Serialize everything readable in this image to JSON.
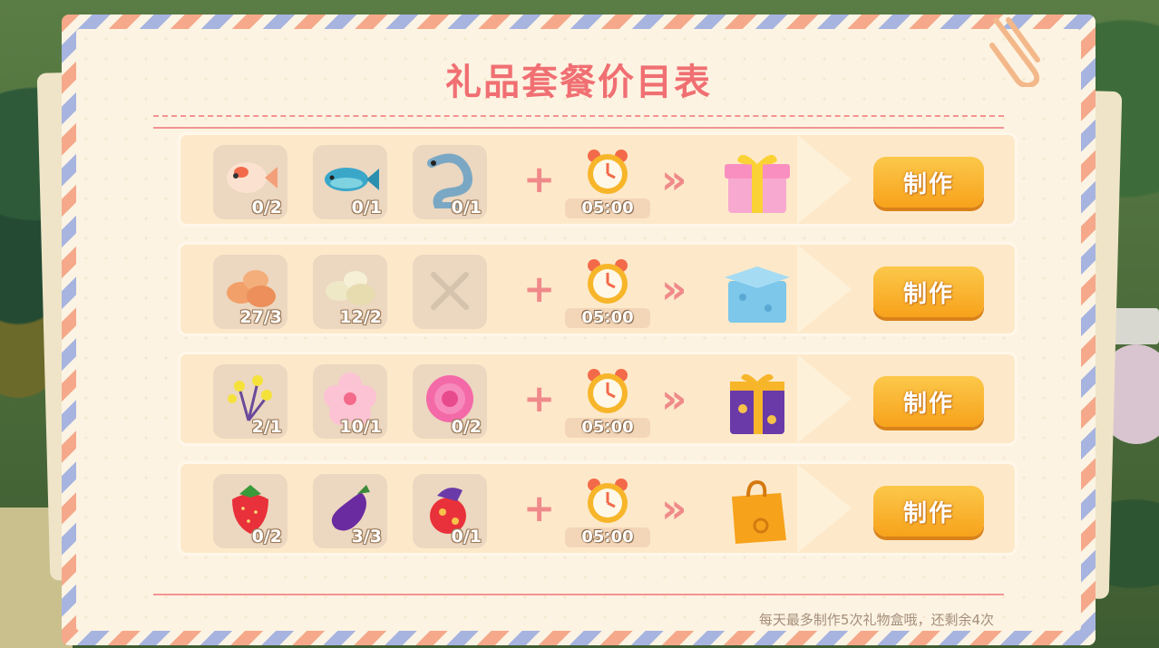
{
  "panel": {
    "title": "礼品套餐价目表",
    "footer_note": "每天最多制作5次礼物盒哦，还剩余4次"
  },
  "colors": {
    "accent": "#f06f72",
    "button": "#f7a21b",
    "row_bg": "#fde9c9"
  },
  "recipes": [
    {
      "ingredients": [
        {
          "icon": "koi-fish-icon",
          "count": "0/2"
        },
        {
          "icon": "blue-fish-icon",
          "count": "0/1"
        },
        {
          "icon": "eel-icon",
          "count": "0/1"
        }
      ],
      "plus": "+",
      "time": "05:00",
      "arrow": "»",
      "result_icon": "pink-gift-box-icon",
      "button": "制作"
    },
    {
      "ingredients": [
        {
          "icon": "brown-eggs-icon",
          "count": "27/3"
        },
        {
          "icon": "white-eggs-icon",
          "count": "12/2"
        },
        {
          "icon": "empty-slot-x-icon",
          "count": ""
        }
      ],
      "plus": "+",
      "time": "05:00",
      "arrow": "»",
      "result_icon": "blue-gift-box-icon",
      "button": "制作"
    },
    {
      "ingredients": [
        {
          "icon": "yellow-flower-icon",
          "count": "2/1"
        },
        {
          "icon": "pink-blossom-icon",
          "count": "10/1"
        },
        {
          "icon": "pink-peony-icon",
          "count": "0/2"
        }
      ],
      "plus": "+",
      "time": "05:00",
      "arrow": "»",
      "result_icon": "purple-gift-box-icon",
      "button": "制作"
    },
    {
      "ingredients": [
        {
          "icon": "strawberry-icon",
          "count": "0/2"
        },
        {
          "icon": "eggplant-icon",
          "count": "3/3"
        },
        {
          "icon": "red-fruit-icon",
          "count": "0/1"
        }
      ],
      "plus": "+",
      "time": "05:00",
      "arrow": "»",
      "result_icon": "orange-gift-bag-icon",
      "button": "制作"
    }
  ]
}
